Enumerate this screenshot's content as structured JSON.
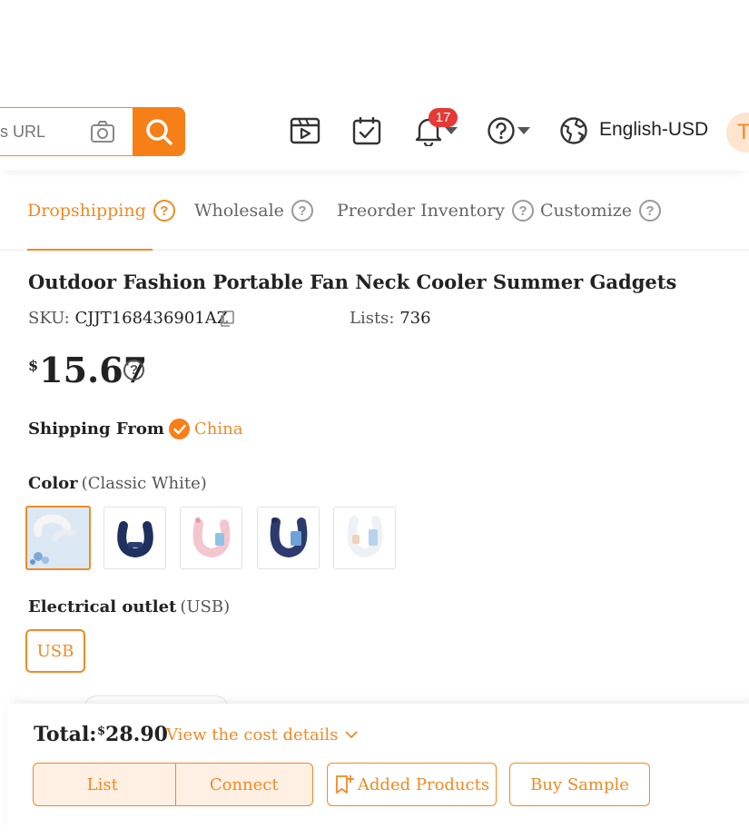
{
  "header": {
    "search_placeholder": "ess URL",
    "notification_count": "17",
    "language": "English-USD",
    "avatar_initial": "T",
    "icons": [
      "video-icon",
      "calendar-check-icon",
      "bell-icon",
      "help-icon",
      "globe-icon"
    ]
  },
  "tabs": [
    {
      "label": "Dropshipping",
      "active": true
    },
    {
      "label": "Wholesale",
      "active": false
    },
    {
      "label": "Preorder Inventory",
      "active": false
    },
    {
      "label": "Customize",
      "active": false
    }
  ],
  "product": {
    "title": "Outdoor Fashion Portable Fan Neck Cooler Summer Gadgets",
    "sku_label": "SKU:",
    "sku": "CJJT168436901AZ",
    "lists_label": "Lists:",
    "lists": "736",
    "currency": "$",
    "price": "15.67",
    "shipping_label": "Shipping From",
    "shipping_from": "China",
    "color_label": "Color",
    "color_selected": "(Classic White)",
    "color_swatches": [
      "Classic White",
      "Navy Blue",
      "Pink",
      "Dark Blue",
      "White Gradient"
    ],
    "outlet_label": "Electrical outlet",
    "outlet_selected": "(USB)",
    "outlet_option": "USB"
  },
  "footer": {
    "total_label": "Total:",
    "total_currency": "$",
    "total_value": "28.90",
    "cost_link": "View the cost details",
    "buttons": {
      "list": "List",
      "connect": "Connect",
      "added": "Added Products",
      "buy_sample": "Buy Sample"
    }
  },
  "colors": {
    "accent": "#f77f17",
    "badge": "#e53935"
  }
}
